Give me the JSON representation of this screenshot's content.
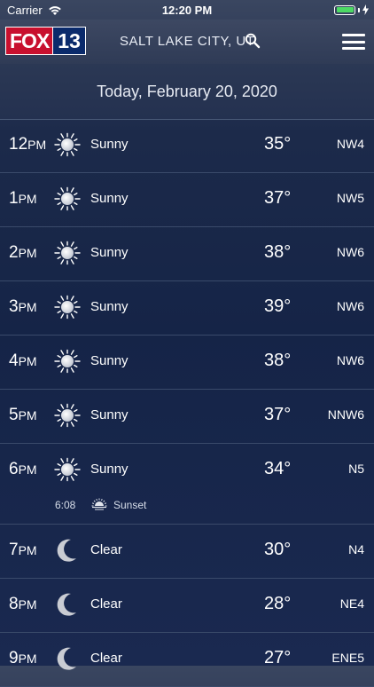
{
  "status": {
    "carrier": "Carrier",
    "time": "12:20 PM"
  },
  "header": {
    "logo_fox": "FOX",
    "logo_num": "13",
    "city": "SALT LAKE CITY, UT"
  },
  "date_label": "Today, February 20, 2020",
  "hours": [
    {
      "num": "12",
      "ampm": "PM",
      "icon": "sun-icon",
      "cond": "Sunny",
      "temp": "35°",
      "wind": "NW4"
    },
    {
      "num": "1",
      "ampm": "PM",
      "icon": "sun-icon",
      "cond": "Sunny",
      "temp": "37°",
      "wind": "NW5"
    },
    {
      "num": "2",
      "ampm": "PM",
      "icon": "sun-icon",
      "cond": "Sunny",
      "temp": "38°",
      "wind": "NW6"
    },
    {
      "num": "3",
      "ampm": "PM",
      "icon": "sun-icon",
      "cond": "Sunny",
      "temp": "39°",
      "wind": "NW6"
    },
    {
      "num": "4",
      "ampm": "PM",
      "icon": "sun-icon",
      "cond": "Sunny",
      "temp": "38°",
      "wind": "NW6"
    },
    {
      "num": "5",
      "ampm": "PM",
      "icon": "sun-icon",
      "cond": "Sunny",
      "temp": "37°",
      "wind": "NNW6"
    },
    {
      "num": "6",
      "ampm": "PM",
      "icon": "sun-icon",
      "cond": "Sunny",
      "temp": "34°",
      "wind": "N5"
    },
    {
      "num": "7",
      "ampm": "PM",
      "icon": "moon-icon",
      "cond": "Clear",
      "temp": "30°",
      "wind": "N4"
    },
    {
      "num": "8",
      "ampm": "PM",
      "icon": "moon-icon",
      "cond": "Clear",
      "temp": "28°",
      "wind": "NE4"
    },
    {
      "num": "9",
      "ampm": "PM",
      "icon": "moon-icon",
      "cond": "Clear",
      "temp": "27°",
      "wind": "ENE5"
    }
  ],
  "sunset": {
    "time": "6:08",
    "label": "Sunset",
    "icon": "sunset-icon"
  },
  "colors": {
    "brand_red": "#c8102e",
    "brand_blue": "#0a2a6b",
    "battery_green": "#4cd964"
  }
}
